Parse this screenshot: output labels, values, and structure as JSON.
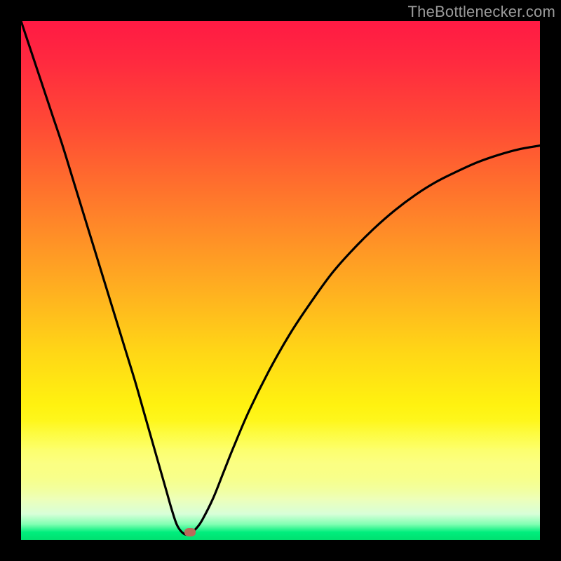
{
  "watermark": {
    "text": "TheBottlenecker.com"
  },
  "chart_data": {
    "type": "line",
    "title": "",
    "xlabel": "",
    "ylabel": "",
    "xlim": [
      0,
      100
    ],
    "ylim": [
      0,
      100
    ],
    "annotations": [],
    "marker": {
      "x": 32.5,
      "y": 1.5,
      "color": "#b96a5a"
    },
    "gradient_stops": [
      {
        "pct": 0,
        "color": "#ff1a44"
      },
      {
        "pct": 40,
        "color": "#ff8a28"
      },
      {
        "pct": 74,
        "color": "#fff210"
      },
      {
        "pct": 97,
        "color": "#80ffb2"
      },
      {
        "pct": 100,
        "color": "#00e070"
      }
    ],
    "series": [
      {
        "name": "bottleneck-curve",
        "x": [
          0,
          2,
          4,
          6,
          8,
          10,
          12,
          14,
          16,
          18,
          20,
          22,
          24,
          26,
          28,
          29,
          30,
          31,
          32,
          33,
          34,
          35,
          37,
          39,
          41,
          44,
          48,
          52,
          56,
          60,
          64,
          68,
          72,
          76,
          80,
          84,
          88,
          92,
          96,
          100
        ],
        "y": [
          100,
          94,
          88,
          82,
          76,
          69.5,
          63,
          56.5,
          50,
          43.5,
          37,
          30.5,
          23.5,
          16.5,
          9.5,
          6,
          3,
          1.5,
          1,
          1.5,
          2.5,
          4,
          8,
          13,
          18,
          25,
          33,
          40,
          46,
          51.5,
          56,
          60,
          63.5,
          66.5,
          69,
          71,
          72.8,
          74.2,
          75.3,
          76
        ]
      }
    ]
  }
}
